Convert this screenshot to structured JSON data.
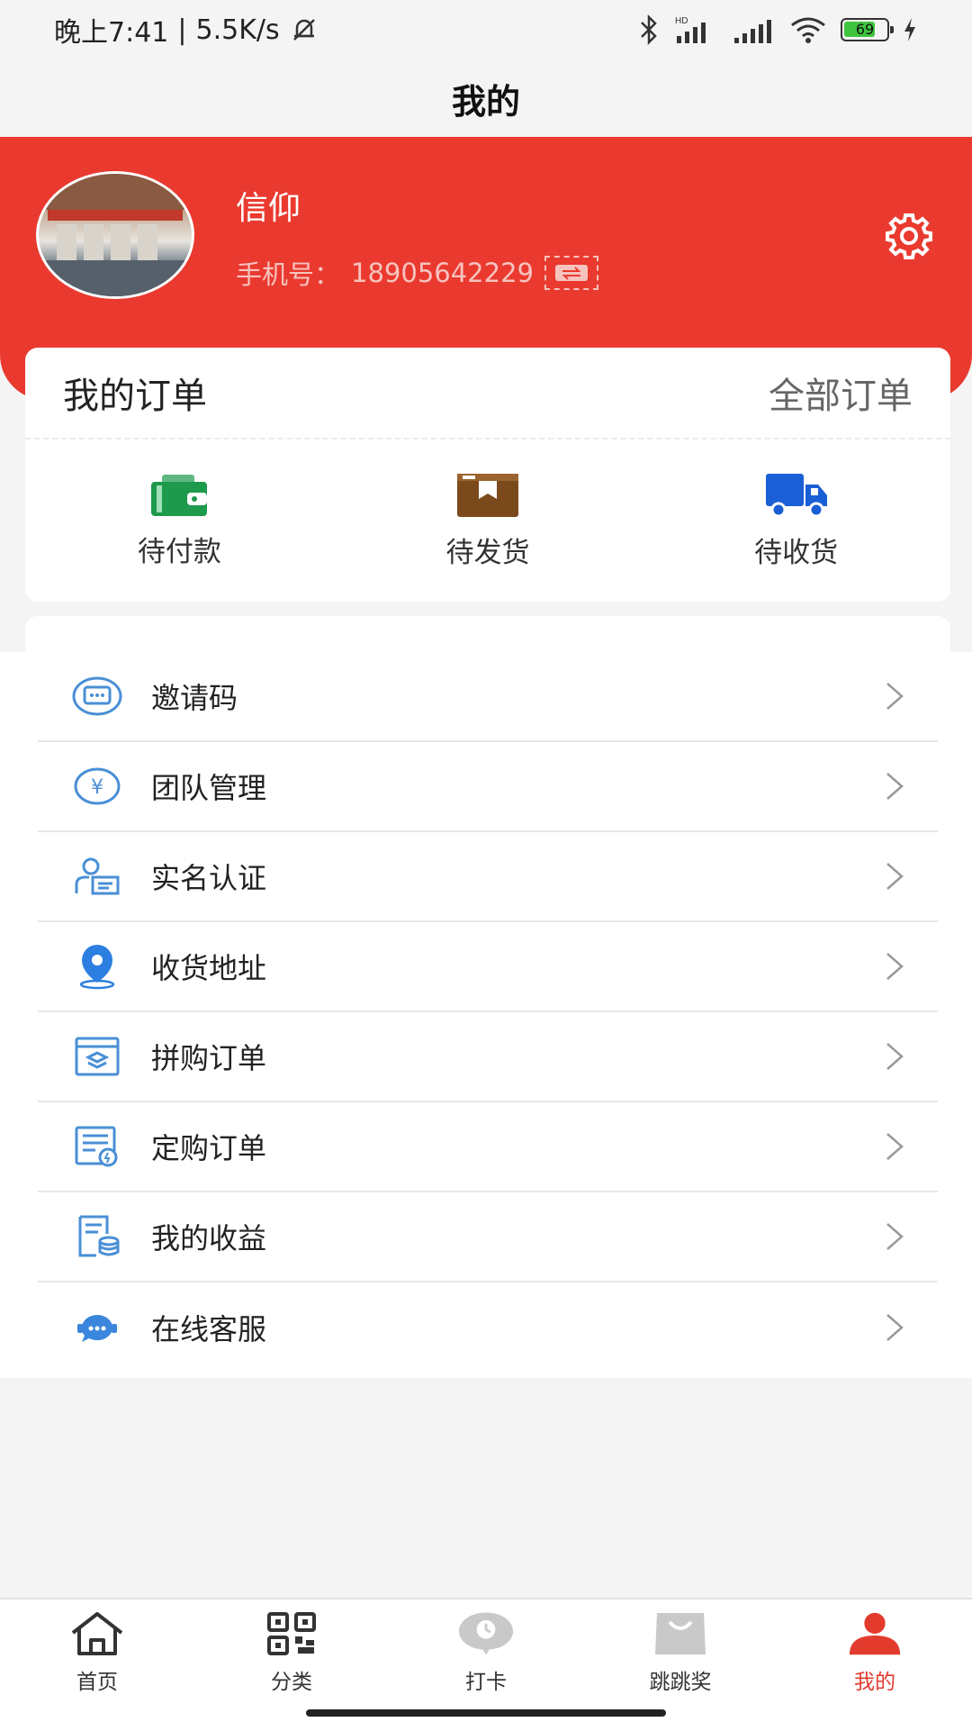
{
  "status_bar": {
    "time": "晚上7:41",
    "separator": "|",
    "speed": "5.5K/s",
    "battery": "69",
    "icons": [
      "mute-bell-icon",
      "bluetooth-icon",
      "hd-signal-icon",
      "signal-icon",
      "wifi-icon",
      "battery-icon",
      "charging-icon"
    ]
  },
  "header": {
    "title": "我的"
  },
  "profile": {
    "name": "信仰",
    "phone_label": "手机号：",
    "phone": "18905642229",
    "accent_color": "#ea3a2f"
  },
  "orders": {
    "title": "我的订单",
    "all_label": "全部订单",
    "items": [
      {
        "label": "待付款",
        "icon": "wallet-icon",
        "color": "#1d9a4c"
      },
      {
        "label": "待发货",
        "icon": "package-icon",
        "color": "#7b4a1c"
      },
      {
        "label": "待收货",
        "icon": "truck-icon",
        "color": "#1a5fd6"
      }
    ]
  },
  "menu": {
    "items": [
      {
        "label": "邀请码",
        "icon": "message-icon"
      },
      {
        "label": "团队管理",
        "icon": "yen-icon"
      },
      {
        "label": "实名认证",
        "icon": "id-card-icon"
      },
      {
        "label": "收货地址",
        "icon": "location-pin-icon"
      },
      {
        "label": "拼购订单",
        "icon": "layers-icon"
      },
      {
        "label": "定购订单",
        "icon": "document-icon"
      },
      {
        "label": "我的收益",
        "icon": "earnings-icon"
      },
      {
        "label": "在线客服",
        "icon": "chat-bubble-icon"
      }
    ]
  },
  "tabbar": {
    "items": [
      {
        "label": "首页",
        "icon": "home-icon",
        "active": false
      },
      {
        "label": "分类",
        "icon": "qr-code-icon",
        "active": false
      },
      {
        "label": "打卡",
        "icon": "clock-pin-icon",
        "active": false
      },
      {
        "label": "跳跳奖",
        "icon": "bag-icon",
        "active": false
      },
      {
        "label": "我的",
        "icon": "user-icon",
        "active": true
      }
    ],
    "active_color": "#e23b2e"
  }
}
